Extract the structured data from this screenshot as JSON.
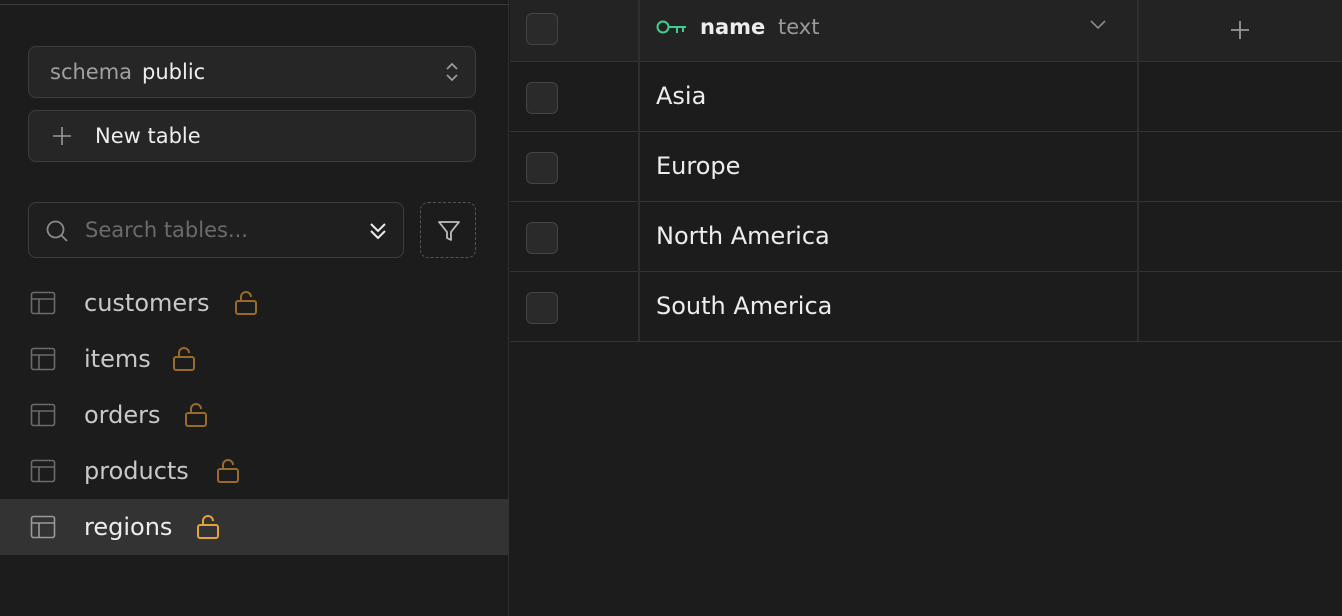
{
  "sidebar": {
    "schema": {
      "prefix": "schema",
      "value": "public"
    },
    "new_table_label": "New table",
    "search": {
      "placeholder": "Search tables..."
    },
    "tables": [
      {
        "name": "customers",
        "lock_color": "#9a6a2a",
        "active": false
      },
      {
        "name": "items",
        "lock_color": "#9a6a2a",
        "active": false
      },
      {
        "name": "orders",
        "lock_color": "#9a6a2a",
        "active": false
      },
      {
        "name": "products",
        "lock_color": "#9a6a2a",
        "active": false
      },
      {
        "name": "regions",
        "lock_color": "#e3a33b",
        "active": true
      }
    ]
  },
  "grid": {
    "column": {
      "name": "name",
      "type": "text",
      "key_icon_color": "#3ecf8e"
    },
    "rows": [
      "Asia",
      "Europe",
      "North America",
      "South America"
    ]
  }
}
